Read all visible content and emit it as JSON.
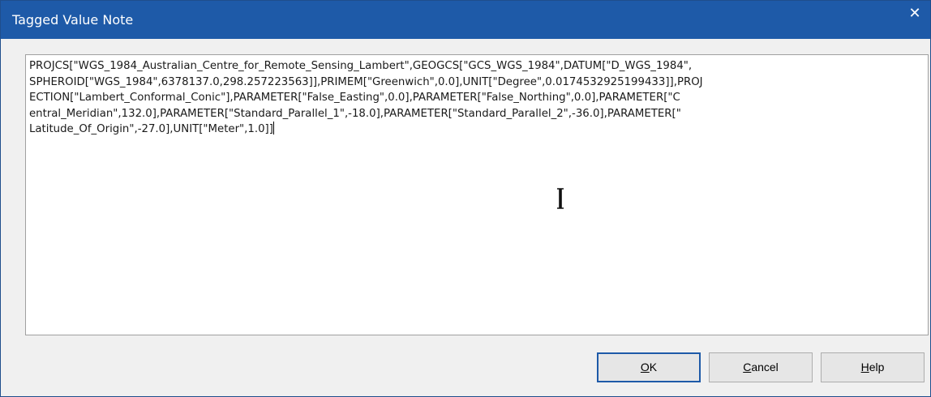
{
  "window": {
    "title": "Tagged Value Note",
    "close_glyph": "✕"
  },
  "note": {
    "line1": "PROJCS[\"WGS_1984_Australian_Centre_for_Remote_Sensing_Lambert\",GEOGCS[\"GCS_WGS_1984\",DATUM[\"D_WGS_1984\",",
    "line2": "SPHEROID[\"WGS_1984\",6378137.0,298.257223563]],PRIMEM[\"Greenwich\",0.0],UNIT[\"Degree\",0.0174532925199433]],PROJ",
    "line3": "ECTION[\"Lambert_Conformal_Conic\"],PARAMETER[\"False_Easting\",0.0],PARAMETER[\"False_Northing\",0.0],PARAMETER[\"C",
    "line4": "entral_Meridian\",132.0],PARAMETER[\"Standard_Parallel_1\",-18.0],PARAMETER[\"Standard_Parallel_2\",-36.0],PARAMETER[\"",
    "line5": "Latitude_Of_Origin\",-27.0],UNIT[\"Meter\",1.0]]"
  },
  "buttons": {
    "ok_label_mnemonic": "O",
    "ok_label_rest": "K",
    "cancel_label_mnemonic": "C",
    "cancel_label_rest": "ancel",
    "help_label_mnemonic": "H",
    "help_label_rest": "elp"
  },
  "icons": {
    "close": "close-icon",
    "text_cursor": "ibeam-cursor-icon"
  },
  "colors": {
    "titlebar": "#1e5aa8",
    "default_button_border": "#1e5aa8"
  }
}
